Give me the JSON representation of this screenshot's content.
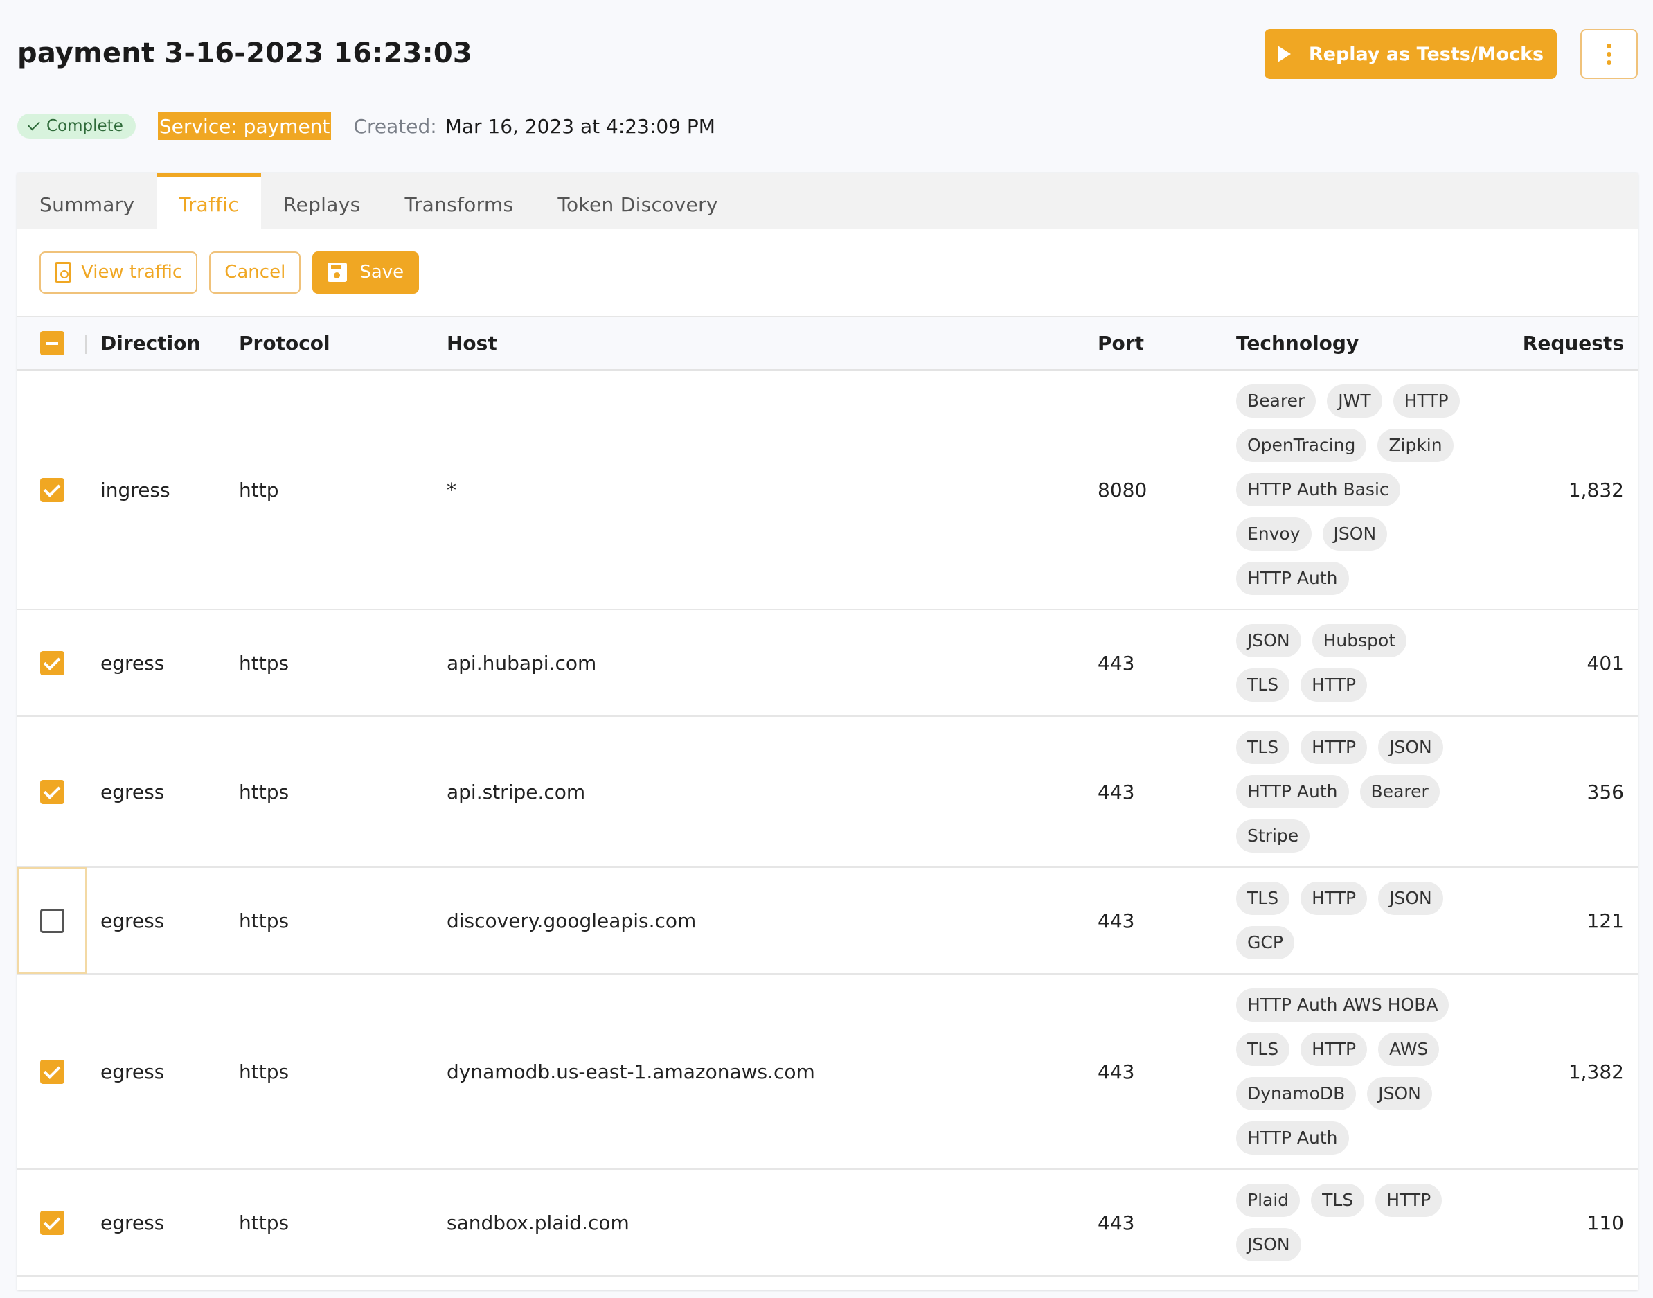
{
  "header": {
    "title": "payment 3-16-2023 16:23:03",
    "replay_label": "Replay as Tests/Mocks",
    "more_icon": "more-vertical-icon"
  },
  "meta": {
    "status": "Complete",
    "service": "Service: payment",
    "created_label": "Created:",
    "created_value": "Mar 16, 2023 at 4:23:09 PM"
  },
  "tabs": [
    {
      "label": "Summary",
      "active": false
    },
    {
      "label": "Traffic",
      "active": true
    },
    {
      "label": "Replays",
      "active": false
    },
    {
      "label": "Transforms",
      "active": false
    },
    {
      "label": "Token Discovery",
      "active": false
    }
  ],
  "toolbar": {
    "view_traffic": "View traffic",
    "cancel": "Cancel",
    "save": "Save"
  },
  "table": {
    "columns": [
      "Direction",
      "Protocol",
      "Host",
      "Port",
      "Technology",
      "Requests"
    ],
    "rows": [
      {
        "checked": true,
        "direction": "ingress",
        "protocol": "http",
        "host": "*",
        "port": "8080",
        "tech": [
          "Bearer",
          "JWT",
          "HTTP",
          "OpenTracing",
          "Zipkin",
          "HTTP Auth Basic",
          "Envoy",
          "JSON",
          "HTTP Auth"
        ],
        "requests": "1,832"
      },
      {
        "checked": true,
        "direction": "egress",
        "protocol": "https",
        "host": "api.hubapi.com",
        "port": "443",
        "tech": [
          "JSON",
          "Hubspot",
          "TLS",
          "HTTP"
        ],
        "requests": "401"
      },
      {
        "checked": true,
        "direction": "egress",
        "protocol": "https",
        "host": "api.stripe.com",
        "port": "443",
        "tech": [
          "TLS",
          "HTTP",
          "JSON",
          "HTTP Auth",
          "Bearer",
          "Stripe"
        ],
        "requests": "356"
      },
      {
        "checked": false,
        "direction": "egress",
        "protocol": "https",
        "host": "discovery.googleapis.com",
        "port": "443",
        "tech": [
          "TLS",
          "HTTP",
          "JSON",
          "GCP"
        ],
        "requests": "121"
      },
      {
        "checked": true,
        "direction": "egress",
        "protocol": "https",
        "host": "dynamodb.us-east-1.amazonaws.com",
        "port": "443",
        "tech": [
          "HTTP Auth AWS HOBA",
          "TLS",
          "HTTP",
          "AWS",
          "DynamoDB",
          "JSON",
          "HTTP Auth"
        ],
        "requests": "1,382"
      },
      {
        "checked": true,
        "direction": "egress",
        "protocol": "https",
        "host": "sandbox.plaid.com",
        "port": "443",
        "tech": [
          "Plaid",
          "TLS",
          "HTTP",
          "JSON"
        ],
        "requests": "110"
      }
    ]
  },
  "colors": {
    "accent": "#f0a723",
    "status_bg": "#d8f3dd",
    "chip_bg": "#ececec"
  }
}
